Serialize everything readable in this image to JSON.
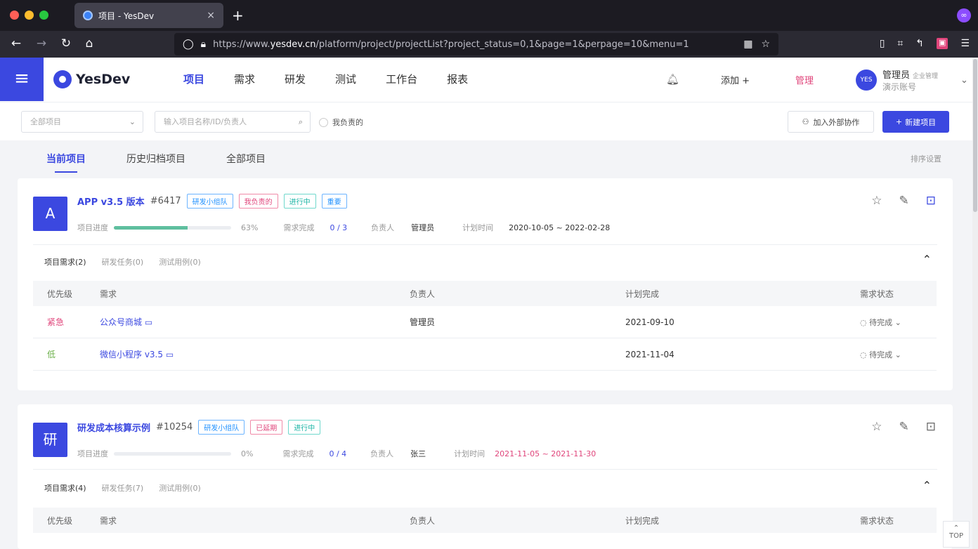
{
  "browser": {
    "tab_title": "项目 - YesDev",
    "tab_close": "×",
    "new_tab": "+",
    "url_domain": "yesdev.cn",
    "url_prefix": "https://www.",
    "url_path": "/platform/project/projectList?project_status=0,1&page=1&perpage=10&menu=1"
  },
  "app": {
    "logo": "YesDev",
    "nav": [
      "项目",
      "需求",
      "研发",
      "测试",
      "工作台",
      "报表"
    ],
    "add_label": "添加 +",
    "admin_label": "管理",
    "user_name": "管理员",
    "user_role": "企业管理",
    "user_account": "演示账号",
    "avatar_text": "YES"
  },
  "filters": {
    "select_placeholder": "全部项目",
    "search_placeholder": "输入项目名称/ID/负责人",
    "radio_label": "我负责的",
    "join_button": "加入外部协作",
    "new_button": "新建项目"
  },
  "subtabs": [
    "当前项目",
    "历史归档项目",
    "全部项目"
  ],
  "sort_label": "排序设置",
  "projects": [
    {
      "badge": "A",
      "name": "APP v3.5 版本",
      "code": "#6417",
      "tags": [
        "研发小组队",
        "我负责的",
        "进行中",
        "重要"
      ],
      "progress_label": "项目进度",
      "progress": 0.63,
      "progress_text": "63%",
      "req_label": "需求完成",
      "req_value": "0 / 3",
      "owner_label": "负责人",
      "owner": "管理员",
      "plan_label": "计划时间",
      "plan": "2020-10-05 ~ 2022-02-28",
      "inner_tabs": [
        "项目需求(2)",
        "研发任务(0)",
        "测试用例(0)"
      ],
      "columns": [
        "优先级",
        "需求",
        "负责人",
        "计划完成",
        "需求状态"
      ],
      "rows": [
        {
          "priority": "紧急",
          "title": "公众号商城",
          "owner": "管理员",
          "due": "2021-09-10",
          "status": "待完成"
        },
        {
          "priority": "低",
          "title": "微信小程序 v3.5",
          "owner": "",
          "due": "2021-11-04",
          "status": "待完成"
        }
      ]
    },
    {
      "badge": "研",
      "name": "研发成本核算示例",
      "code": "#10254",
      "tags": [
        "研发小组队",
        "已延期",
        "进行中"
      ],
      "progress_label": "项目进度",
      "progress": 0,
      "progress_text": "0%",
      "req_label": "需求完成",
      "req_value": "0 / 4",
      "owner_label": "负责人",
      "owner": "张三",
      "plan_label": "计划时间",
      "plan": "2021-11-05 ~ 2021-11-30",
      "inner_tabs": [
        "项目需求(4)",
        "研发任务(7)",
        "测试用例(0)"
      ],
      "columns": [
        "优先级",
        "需求",
        "负责人",
        "计划完成",
        "需求状态"
      ]
    }
  ],
  "scroll_top": "TOP",
  "colors": {
    "accent": "#3b48e0",
    "danger": "#e0457b",
    "success": "#5fbf9f"
  }
}
